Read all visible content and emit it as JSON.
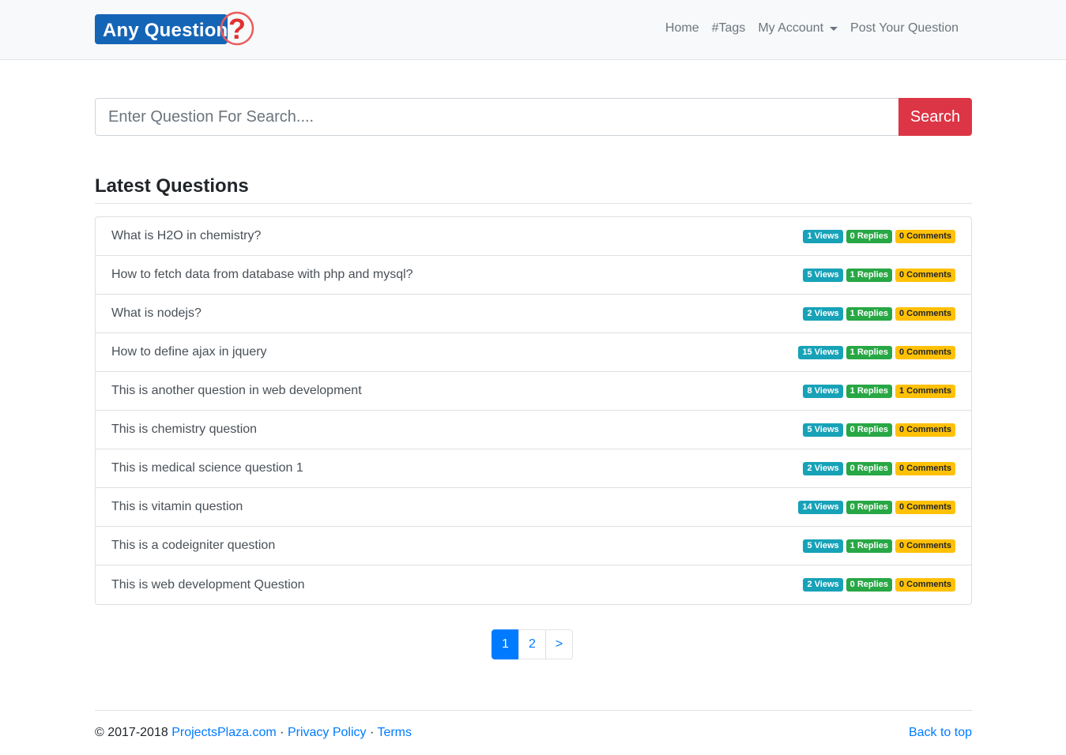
{
  "brand": {
    "text": "Any Question",
    "q_mark": "?"
  },
  "nav": {
    "home": "Home",
    "tags": "#Tags",
    "account": "My Account",
    "post": "Post Your Question"
  },
  "search": {
    "placeholder": "Enter Question For Search....",
    "button": "Search"
  },
  "section": {
    "title": "Latest Questions"
  },
  "questions": [
    {
      "title": "What is H2O in chemistry?",
      "views": "1 Views",
      "replies": "0 Replies",
      "comments": "0 Comments"
    },
    {
      "title": "How to fetch data from database with php and mysql?",
      "views": "5 Views",
      "replies": "1 Replies",
      "comments": "0 Comments"
    },
    {
      "title": "What is nodejs?",
      "views": "2 Views",
      "replies": "1 Replies",
      "comments": "0 Comments"
    },
    {
      "title": "How to define ajax in jquery",
      "views": "15 Views",
      "replies": "1 Replies",
      "comments": "0 Comments"
    },
    {
      "title": "This is another question in web development",
      "views": "8 Views",
      "replies": "1 Replies",
      "comments": "1 Comments"
    },
    {
      "title": "This is chemistry question",
      "views": "5 Views",
      "replies": "0 Replies",
      "comments": "0 Comments"
    },
    {
      "title": "This is medical science question 1",
      "views": "2 Views",
      "replies": "0 Replies",
      "comments": "0 Comments"
    },
    {
      "title": "This is vitamin question",
      "views": "14 Views",
      "replies": "0 Replies",
      "comments": "0 Comments"
    },
    {
      "title": "This is a codeigniter question",
      "views": "5 Views",
      "replies": "1 Replies",
      "comments": "0 Comments"
    },
    {
      "title": "This is web development Question",
      "views": "2 Views",
      "replies": "0 Replies",
      "comments": "0 Comments"
    }
  ],
  "pagination": {
    "pages": [
      "1",
      "2"
    ],
    "next": ">",
    "active": "1"
  },
  "footer": {
    "copyright": "© 2017-2018",
    "site": "ProjectsPlaza.com",
    "sep": "·",
    "privacy": "Privacy Policy",
    "terms": "Terms",
    "back_to_top": "Back to top"
  },
  "colors": {
    "brand_blue": "#1565b7",
    "search_red": "#dc3545",
    "views_badge": "#17a2b8",
    "replies_badge": "#28a745",
    "comments_badge": "#ffc107",
    "link_blue": "#007bff"
  }
}
